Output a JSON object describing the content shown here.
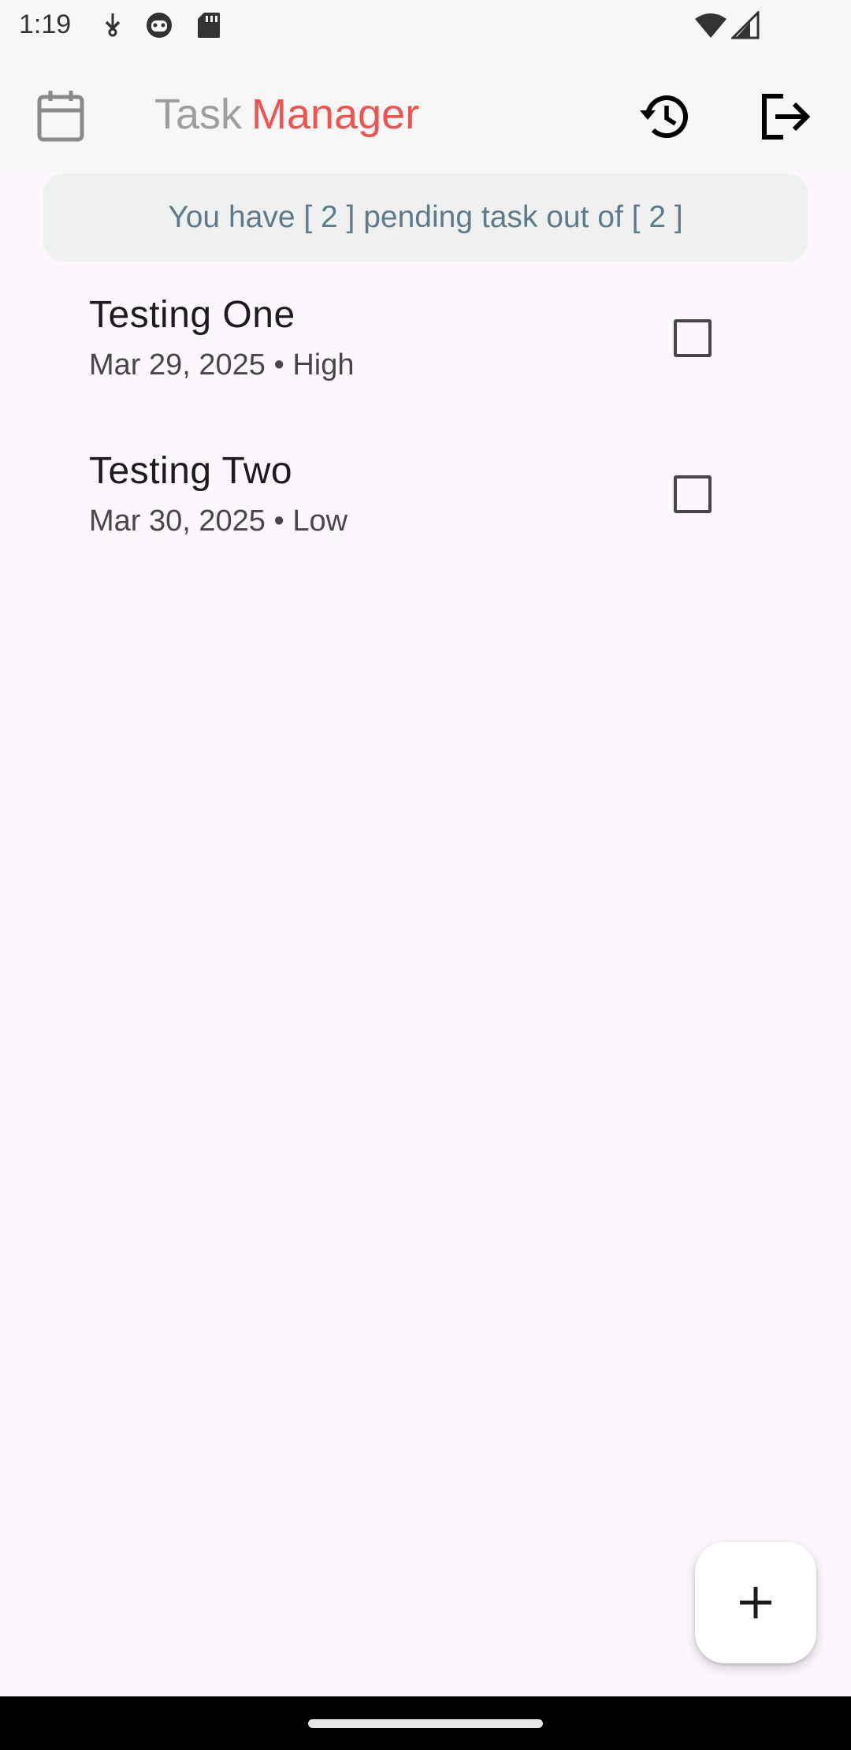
{
  "status_bar": {
    "time": "1:19",
    "icons": [
      "usb-debug-icon",
      "face-icon",
      "sd-card-icon",
      "wifi-icon",
      "signal-icon"
    ]
  },
  "app_bar": {
    "title_part1": "Task",
    "title_part2": "Manager",
    "colors": {
      "title_part1": "#9e9e9e",
      "title_part2": "#ef5350"
    },
    "icons": [
      "calendar-icon",
      "history-icon",
      "logout-icon"
    ]
  },
  "summary": {
    "text": "You have [ 2 ] pending task out of [ 2 ]"
  },
  "tasks": [
    {
      "title": "Testing One",
      "subtitle": "Mar 29, 2025 • High",
      "checked": false
    },
    {
      "title": "Testing Two",
      "subtitle": "Mar 30, 2025 • Low",
      "checked": false
    }
  ],
  "fab": {
    "icon": "plus-icon"
  }
}
